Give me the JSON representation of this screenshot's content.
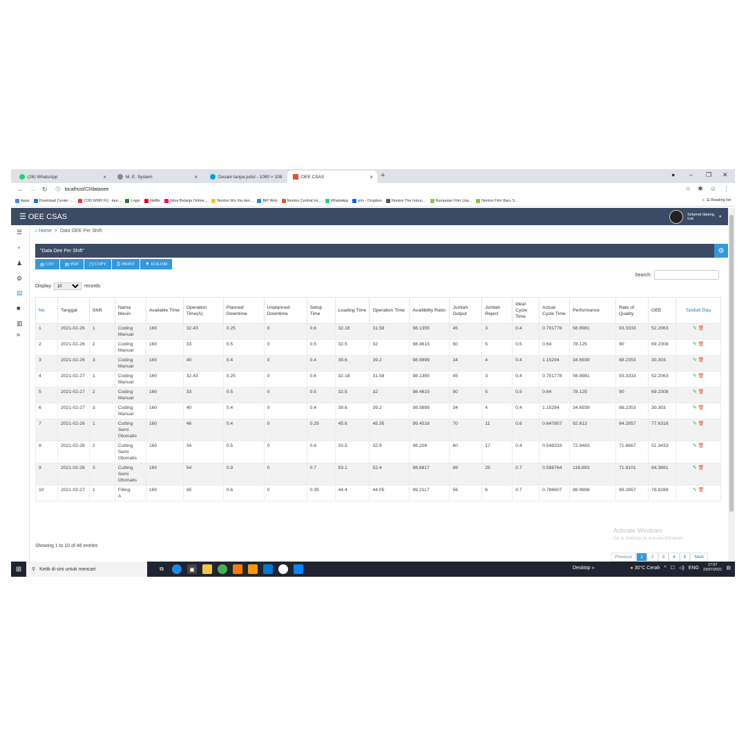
{
  "browser": {
    "tabs": [
      {
        "label": "(26) WhatsApp"
      },
      {
        "label": "M. E. System"
      },
      {
        "label": "Desain tanpa judul - 1080 × 108"
      },
      {
        "label": "OEE CSAS"
      }
    ],
    "url": "localhost/CI/dataoee",
    "bookmarks": [
      "Apps",
      "Download Center -...",
      "COD WWII FU - kee...",
      "Login",
      "Netflix",
      "Situs Belanja Online...",
      "Nonton Wu Xia den...",
      "BiP Web",
      "Nonton Central Int...",
      "WhatsApp",
      "priv - Dropbox",
      "Nonton The Intouc...",
      "Kumpulan Film Usa...",
      "Nonton Film Baru S..."
    ],
    "reading_list": "Reading list"
  },
  "app": {
    "brand": "OEE CSAS",
    "greeting_line1": "Selamat datang,",
    "greeting_line2": "Ical"
  },
  "breadcrumb": {
    "home": "Home",
    "current": "Data OEE Per Shift"
  },
  "panel": {
    "title": "\"Data Oee Per Shift\""
  },
  "toolbar": {
    "csv": "CSV",
    "pdf": "PDF",
    "copy": "COPY",
    "print": "PRINT",
    "kolom": "KOLOM"
  },
  "search": {
    "label": "Search:",
    "value": ""
  },
  "display": {
    "label": "Display",
    "value": "10",
    "suffix": "records"
  },
  "table": {
    "columns": [
      "No",
      "Tanggal",
      "Shift",
      "Nama Mesin",
      "Available Time",
      "Operation Time(A)",
      "Planned Downtime",
      "Unplanned Downtime",
      "Setup Time",
      "Loading Time",
      "Operation Time",
      "Availibility Ratio",
      "Jumlah Output",
      "Jumlah Reject",
      "Ideal Cycle Time",
      "Actual Cycle Time",
      "Performance",
      "Rate of Quality",
      "OEE",
      "Tambah Data"
    ],
    "rows": [
      [
        "1",
        "2021-02-26",
        "1",
        "Coding Manual",
        "160",
        "32.43",
        "0.25",
        "0",
        "0.6",
        "32.18",
        "31.58",
        "98.1355",
        "45",
        "3",
        "0.4",
        "0.701778",
        "56.9981",
        "93.3333",
        "52.2063"
      ],
      [
        "2",
        "2021-02-26",
        "2",
        "Coding Manual",
        "160",
        "33",
        "0.5",
        "0",
        "0.5",
        "32.5",
        "32",
        "98.4615",
        "50",
        "5",
        "0.5",
        "0.64",
        "78.125",
        "90",
        "69.2308"
      ],
      [
        "3",
        "2021-02-26",
        "3",
        "Coding Manual",
        "160",
        "40",
        "0.4",
        "0",
        "0.4",
        "39.6",
        "39.2",
        "98.9899",
        "34",
        "4",
        "0.4",
        "1.15294",
        "34.6939",
        "88.2353",
        "30.303"
      ],
      [
        "4",
        "2021-02-27",
        "1",
        "Coding Manual",
        "160",
        "32.43",
        "0.25",
        "0",
        "0.6",
        "32.18",
        "31.58",
        "98.1355",
        "45",
        "3",
        "0.4",
        "0.701778",
        "56.9981",
        "93.3333",
        "52.2063"
      ],
      [
        "5",
        "2021-02-27",
        "2",
        "Coding Manual",
        "160",
        "33",
        "0.5",
        "0",
        "0.5",
        "32.5",
        "32",
        "98.4615",
        "50",
        "5",
        "0.5",
        "0.64",
        "78.125",
        "90",
        "69.2308"
      ],
      [
        "6",
        "2021-02-27",
        "3",
        "Coding Manual",
        "160",
        "40",
        "0.4",
        "0",
        "0.4",
        "39.6",
        "39.2",
        "98.9899",
        "34",
        "4",
        "0.4",
        "1.15294",
        "34.6939",
        "88.2353",
        "30.303"
      ],
      [
        "7",
        "2021-02-26",
        "1",
        "Cutting Semi Otomatis",
        "160",
        "46",
        "0.4",
        "0",
        "0.25",
        "45.6",
        "45.35",
        "99.4518",
        "70",
        "11",
        "0.6",
        "0.647857",
        "92.613",
        "84.2857",
        "77.6316"
      ],
      [
        "8",
        "2021-02-26",
        "2",
        "Cutting Semi Otomatis",
        "160",
        "34",
        "0.5",
        "0",
        "0.6",
        "33.5",
        "32.9",
        "98.209",
        "60",
        "17",
        "0.4",
        "0.548333",
        "72.9483",
        "71.6667",
        "51.3433"
      ],
      [
        "9",
        "2021-02-26",
        "3",
        "Cutting Semi Otomatis",
        "160",
        "54",
        "0.9",
        "0",
        "0.7",
        "53.1",
        "52.4",
        "98.6817",
        "89",
        "25",
        "0.7",
        "0.588764",
        "118.893",
        "71.9101",
        "84.3691"
      ],
      [
        "10",
        "2021-02-27",
        "1",
        "Filling A",
        "160",
        "45",
        "0.6",
        "0",
        "0.35",
        "44.4",
        "44.05",
        "99.2117",
        "56",
        "6",
        "0.7",
        "0.786607",
        "88.9898",
        "89.2857",
        "78.8288"
      ]
    ]
  },
  "footer": {
    "showing": "Showing 1 to 10 of 46 entries",
    "pages": [
      "Previous",
      "1",
      "2",
      "3",
      "4",
      "5",
      "Next"
    ],
    "watermark1": "Activate Windows",
    "watermark2": "Go to Settings to activate Windows."
  },
  "taskbar": {
    "search_placeholder": "Ketik di sini untuk mencari",
    "desktop": "Desktop",
    "weather": "30°C Cerah",
    "lang": "ENG",
    "time": "17:57",
    "date": "23/07/2021"
  },
  "colors": {
    "header": "#3c4b64",
    "accent": "#3498db",
    "link": "#2c6fb5"
  }
}
